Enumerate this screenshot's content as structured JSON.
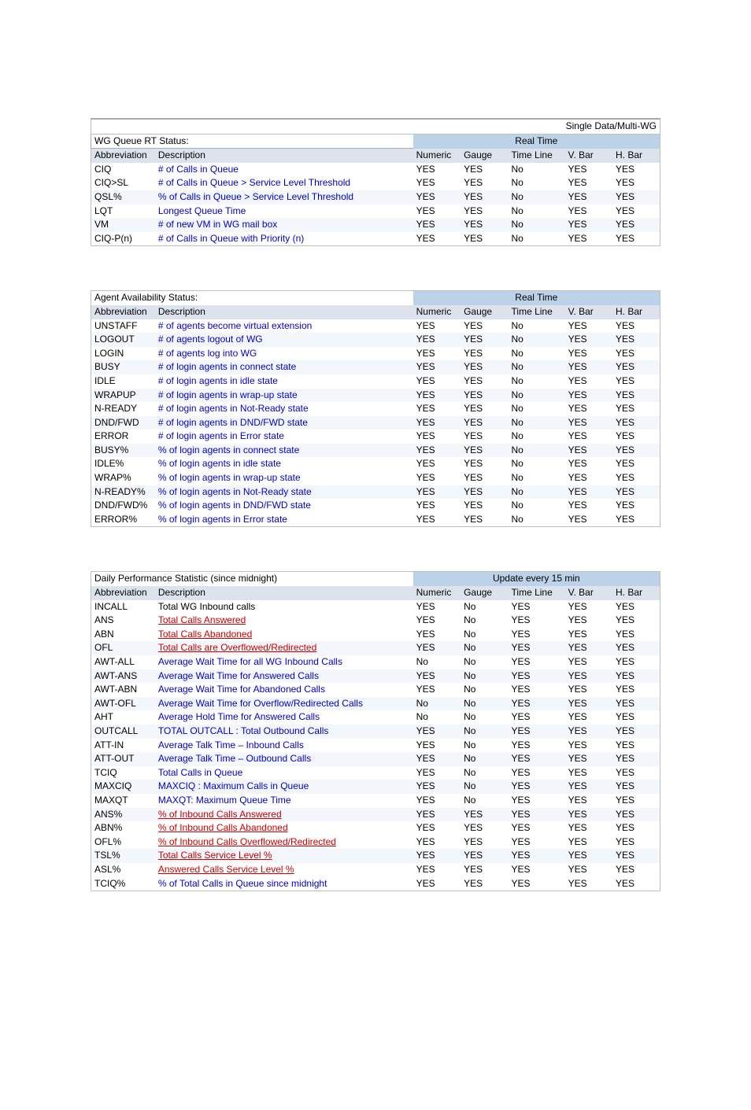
{
  "table1": {
    "topbar_right": "Single Data/Multi-WG",
    "title": "WG Queue RT Status:",
    "group_header": "Real Time",
    "columns": [
      "Abbreviation",
      "Description",
      "Numeric",
      "Gauge",
      "Time Line",
      "V. Bar",
      "H. Bar"
    ],
    "rows": [
      {
        "abbr": "CIQ",
        "desc": "# of Calls in Queue",
        "c": [
          "YES",
          "YES",
          "No",
          "YES",
          "YES"
        ],
        "alt": false
      },
      {
        "abbr": "CIQ>SL",
        "desc": "# of Calls in Queue > Service Level Threshold",
        "c": [
          "YES",
          "YES",
          "No",
          "YES",
          "YES"
        ],
        "alt": false
      },
      {
        "abbr": "QSL%",
        "desc": "% of Calls in Queue > Service Level Threshold",
        "c": [
          "YES",
          "YES",
          "No",
          "YES",
          "YES"
        ],
        "alt": true
      },
      {
        "abbr": "LQT",
        "desc": "Longest Queue Time",
        "c": [
          "YES",
          "YES",
          "No",
          "YES",
          "YES"
        ],
        "alt": false
      },
      {
        "abbr": "VM",
        "desc": "# of new VM in WG mail box",
        "c": [
          "YES",
          "YES",
          "No",
          "YES",
          "YES"
        ],
        "alt": true
      },
      {
        "abbr": "CIQ-P(n)",
        "desc": "# of Calls in Queue with Priority (n)",
        "c": [
          "YES",
          "YES",
          "No",
          "YES",
          "YES"
        ],
        "alt": false
      }
    ]
  },
  "table2": {
    "title": "Agent Availability Status:",
    "group_header": "Real Time",
    "columns": [
      "Abbreviation",
      "Description",
      "Numeric",
      "Gauge",
      "Time Line",
      "V. Bar",
      "H. Bar"
    ],
    "rows": [
      {
        "abbr": "UNSTAFF",
        "desc": "# of agents become virtual extension",
        "c": [
          "YES",
          "YES",
          "No",
          "YES",
          "YES"
        ],
        "alt": false
      },
      {
        "abbr": "LOGOUT",
        "desc": "# of agents logout of WG",
        "c": [
          "YES",
          "YES",
          "No",
          "YES",
          "YES"
        ],
        "alt": true
      },
      {
        "abbr": "LOGIN",
        "desc": "# of agents log into WG",
        "c": [
          "YES",
          "YES",
          "No",
          "YES",
          "YES"
        ],
        "alt": false
      },
      {
        "abbr": "BUSY",
        "desc": "# of login agents in connect state",
        "c": [
          "YES",
          "YES",
          "No",
          "YES",
          "YES"
        ],
        "alt": true
      },
      {
        "abbr": "IDLE",
        "desc": "# of login agents in idle state",
        "c": [
          "YES",
          "YES",
          "No",
          "YES",
          "YES"
        ],
        "alt": false
      },
      {
        "abbr": "WRAPUP",
        "desc": "# of login agents in wrap-up state",
        "c": [
          "YES",
          "YES",
          "No",
          "YES",
          "YES"
        ],
        "alt": true
      },
      {
        "abbr": "N-READY",
        "desc": "# of login agents in Not-Ready state",
        "c": [
          "YES",
          "YES",
          "No",
          "YES",
          "YES"
        ],
        "alt": false
      },
      {
        "abbr": "DND/FWD",
        "desc": "# of login agents in DND/FWD state",
        "c": [
          "YES",
          "YES",
          "No",
          "YES",
          "YES"
        ],
        "alt": true
      },
      {
        "abbr": "ERROR",
        "desc": "# of login agents in Error state",
        "c": [
          "YES",
          "YES",
          "No",
          "YES",
          "YES"
        ],
        "alt": false
      },
      {
        "abbr": "BUSY%",
        "desc": "% of login agents in connect state",
        "c": [
          "YES",
          "YES",
          "No",
          "YES",
          "YES"
        ],
        "alt": true
      },
      {
        "abbr": "IDLE%",
        "desc": "% of login agents in idle state",
        "c": [
          "YES",
          "YES",
          "No",
          "YES",
          "YES"
        ],
        "alt": false
      },
      {
        "abbr": "WRAP%",
        "desc": "% of login agents in wrap-up state",
        "c": [
          "YES",
          "YES",
          "No",
          "YES",
          "YES"
        ],
        "alt": false
      },
      {
        "abbr": "N-READY%",
        "desc": "% of login agents in Not-Ready state",
        "c": [
          "YES",
          "YES",
          "No",
          "YES",
          "YES"
        ],
        "alt": true
      },
      {
        "abbr": "DND/FWD%",
        "desc": "% of login agents in DND/FWD state",
        "c": [
          "YES",
          "YES",
          "No",
          "YES",
          "YES"
        ],
        "alt": false
      },
      {
        "abbr": "ERROR%",
        "desc": "% of login agents in Error state",
        "c": [
          "YES",
          "YES",
          "No",
          "YES",
          "YES"
        ],
        "alt": false
      }
    ]
  },
  "table3": {
    "title": "Daily Performance Statistic (since midnight)",
    "group_header": "Update every 15 min",
    "columns": [
      "Abbreviation",
      "Description",
      "Numeric",
      "Gauge",
      "Time Line",
      "V. Bar",
      "H. Bar"
    ],
    "rows": [
      {
        "abbr": "INCALL",
        "desc": "Total WG Inbound calls",
        "dc": "black",
        "c": [
          "YES",
          "No",
          "YES",
          "YES",
          "YES"
        ],
        "alt": false
      },
      {
        "abbr": "ANS",
        "desc": "Total Calls Answered",
        "dc": "red",
        "c": [
          "YES",
          "No",
          "YES",
          "YES",
          "YES"
        ],
        "alt": false
      },
      {
        "abbr": "ABN",
        "desc": "Total Calls Abandoned",
        "dc": "red",
        "c": [
          "YES",
          "No",
          "YES",
          "YES",
          "YES"
        ],
        "alt": false
      },
      {
        "abbr": "OFL",
        "desc": "Total Calls are Overflowed/Redirected",
        "dc": "red",
        "c": [
          "YES",
          "No",
          "YES",
          "YES",
          "YES"
        ],
        "alt": true
      },
      {
        "abbr": "AWT-ALL",
        "desc": "Average Wait Time for all WG Inbound Calls",
        "dc": "link",
        "c": [
          "No",
          "No",
          "YES",
          "YES",
          "YES"
        ],
        "alt": false
      },
      {
        "abbr": "AWT-ANS",
        "desc": "Average Wait Time for Answered Calls",
        "dc": "link",
        "c": [
          "YES",
          "No",
          "YES",
          "YES",
          "YES"
        ],
        "alt": true
      },
      {
        "abbr": "AWT-ABN",
        "desc": "Average Wait Time for Abandoned Calls",
        "dc": "link",
        "c": [
          "YES",
          "No",
          "YES",
          "YES",
          "YES"
        ],
        "alt": false
      },
      {
        "abbr": "AWT-OFL",
        "desc": "Average Wait Time for Overflow/Redirected Calls",
        "dc": "link",
        "c": [
          "No",
          "No",
          "YES",
          "YES",
          "YES"
        ],
        "alt": true
      },
      {
        "abbr": "AHT",
        "desc": "Average Hold Time for Answered Calls",
        "dc": "link",
        "c": [
          "No",
          "No",
          "YES",
          "YES",
          "YES"
        ],
        "alt": false
      },
      {
        "abbr": "OUTCALL",
        "desc": "TOTAL OUTCALL : Total Outbound Calls",
        "dc": "link",
        "c": [
          "YES",
          "No",
          "YES",
          "YES",
          "YES"
        ],
        "alt": true
      },
      {
        "abbr": "ATT-IN",
        "desc": "Average Talk Time – Inbound Calls",
        "dc": "link",
        "c": [
          "YES",
          "No",
          "YES",
          "YES",
          "YES"
        ],
        "alt": false
      },
      {
        "abbr": "ATT-OUT",
        "desc": "Average Talk Time – Outbound Calls",
        "dc": "link",
        "c": [
          "YES",
          "No",
          "YES",
          "YES",
          "YES"
        ],
        "alt": true
      },
      {
        "abbr": "TCIQ",
        "desc": "Total Calls in Queue",
        "dc": "link",
        "c": [
          "YES",
          "No",
          "YES",
          "YES",
          "YES"
        ],
        "alt": false
      },
      {
        "abbr": "MAXCIQ",
        "desc": "MAXCIQ : Maximum Calls in Queue",
        "dc": "link",
        "c": [
          "YES",
          "No",
          "YES",
          "YES",
          "YES"
        ],
        "alt": true
      },
      {
        "abbr": "MAXQT",
        "desc": "MAXQT: Maximum Queue Time",
        "dc": "link",
        "c": [
          "YES",
          "No",
          "YES",
          "YES",
          "YES"
        ],
        "alt": false
      },
      {
        "abbr": "ANS%",
        "desc": "% of Inbound Calls Answered",
        "dc": "red",
        "c": [
          "YES",
          "YES",
          "YES",
          "YES",
          "YES"
        ],
        "alt": true
      },
      {
        "abbr": "ABN%",
        "desc": "% of Inbound Calls Abandoned",
        "dc": "red",
        "c": [
          "YES",
          "YES",
          "YES",
          "YES",
          "YES"
        ],
        "alt": false
      },
      {
        "abbr": "OFL%",
        "desc": "% of Inbound Calls Overflowed/Redirected",
        "dc": "red",
        "c": [
          "YES",
          "YES",
          "YES",
          "YES",
          "YES"
        ],
        "alt": false
      },
      {
        "abbr": "TSL%",
        "desc": "Total Calls Service Level %",
        "dc": "red",
        "c": [
          "YES",
          "YES",
          "YES",
          "YES",
          "YES"
        ],
        "alt": true
      },
      {
        "abbr": "ASL%",
        "desc": "Answered Calls Service Level %",
        "dc": "red",
        "c": [
          "YES",
          "YES",
          "YES",
          "YES",
          "YES"
        ],
        "alt": false
      },
      {
        "abbr": "TCIQ%",
        "desc": "% of Total Calls in Queue since midnight",
        "dc": "link",
        "c": [
          "YES",
          "YES",
          "YES",
          "YES",
          "YES"
        ],
        "alt": false
      }
    ]
  }
}
